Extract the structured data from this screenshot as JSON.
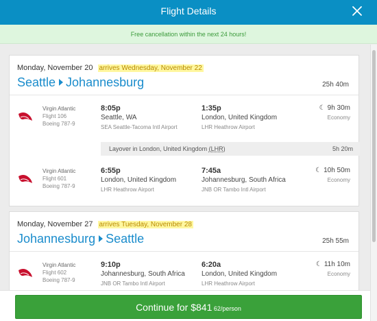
{
  "header": {
    "title": "Flight Details",
    "close_icon": "close-icon"
  },
  "notice": {
    "text": "Free cancellation within the next 24 hours!"
  },
  "trips": [
    {
      "date": "Monday, November 20",
      "arrives": "arrives Wednesday, November 22",
      "origin": "Seattle",
      "destination": "Johannesburg",
      "total_duration": "25h 40m",
      "legs": [
        {
          "airline": "Virgin Atlantic",
          "flight": "Flight 106",
          "aircraft": "Boeing 787-9",
          "dep_time": "8:05p",
          "dep_place": "Seattle, WA",
          "dep_airport": "SEA Seattle-Tacoma Intl Airport",
          "arr_time": "1:35p",
          "arr_place": "London, United Kingdom",
          "arr_airport": "LHR Heathrow Airport",
          "duration": "9h 30m",
          "cabin": "Economy"
        },
        {
          "airline": "Virgin Atlantic",
          "flight": "Flight 601",
          "aircraft": "Boeing 787-9",
          "dep_time": "6:55p",
          "dep_place": "London, United Kingdom",
          "dep_airport": "LHR Heathrow Airport",
          "arr_time": "7:45a",
          "arr_place": "Johannesburg, South Africa",
          "arr_airport": "JNB OR Tambo Intl Airport",
          "duration": "10h 50m",
          "cabin": "Economy"
        }
      ],
      "layover": {
        "prefix": "Layover in London, United Kingdom",
        "code": "(LHR)",
        "duration": "5h 20m"
      }
    },
    {
      "date": "Monday, November 27",
      "arrives": "arrives Tuesday, November 28",
      "origin": "Johannesburg",
      "destination": "Seattle",
      "total_duration": "25h 55m",
      "legs": [
        {
          "airline": "Virgin Atlantic",
          "flight": "Flight 602",
          "aircraft": "Boeing 787-9",
          "dep_time": "9:10p",
          "dep_place": "Johannesburg, South Africa",
          "dep_airport": "JNB OR Tambo Intl Airport",
          "arr_time": "6:20a",
          "arr_place": "London, United Kingdom",
          "arr_airport": "LHR Heathrow Airport",
          "duration": "11h 10m",
          "cabin": "Economy"
        }
      ]
    }
  ],
  "footer": {
    "button_prefix": "Continue for ",
    "price": "$841",
    "per_person": " 62/person"
  },
  "colors": {
    "header": "#0a8fc4",
    "accent": "#1a8ccc",
    "notice_bg": "#def6de",
    "notice_text": "#3a9a3a",
    "button": "#3aa13a",
    "highlight": "#fff7a0"
  }
}
